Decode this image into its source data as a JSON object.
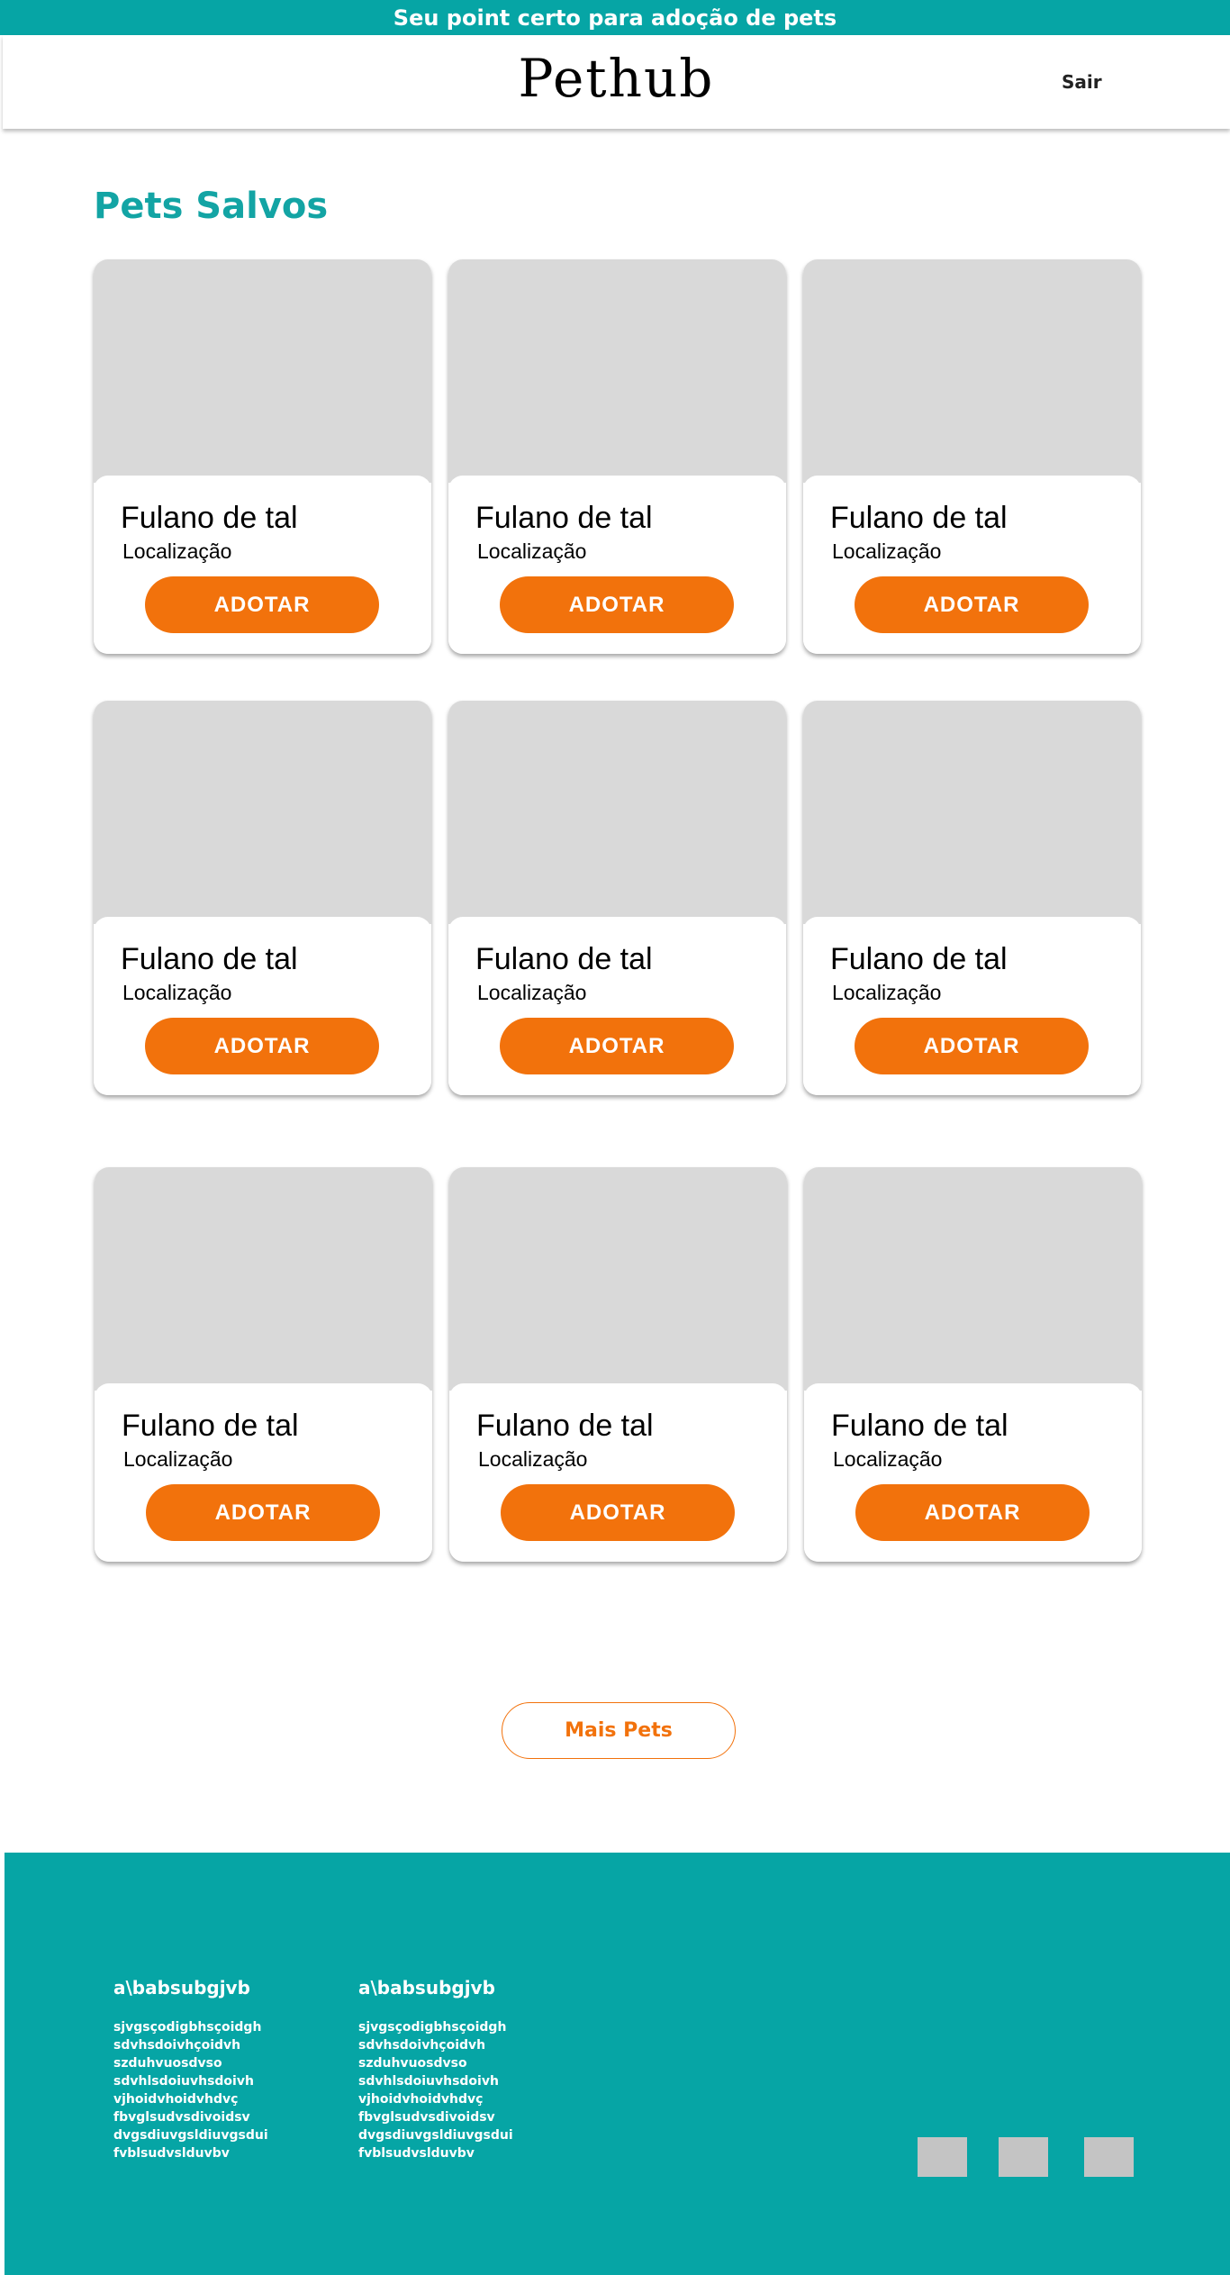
{
  "topbar": {
    "text": "Seu point certo para adoção de pets"
  },
  "header": {
    "logo": "Pethub",
    "logout_label": "Sair"
  },
  "section_title": "Pets Salvos",
  "cards": [
    {
      "name": "Fulano de tal",
      "location": "Localização",
      "button": "ADOTAR"
    },
    {
      "name": "Fulano de tal",
      "location": "Localização",
      "button": "ADOTAR"
    },
    {
      "name": "Fulano de tal",
      "location": "Localização",
      "button": "ADOTAR"
    },
    {
      "name": "Fulano de tal",
      "location": "Localização",
      "button": "ADOTAR"
    },
    {
      "name": "Fulano de tal",
      "location": "Localização",
      "button": "ADOTAR"
    },
    {
      "name": "Fulano de tal",
      "location": "Localização",
      "button": "ADOTAR"
    },
    {
      "name": "Fulano de tal",
      "location": "Localização",
      "button": "ADOTAR"
    },
    {
      "name": "Fulano de tal",
      "location": "Localização",
      "button": "ADOTAR"
    },
    {
      "name": "Fulano de tal",
      "location": "Localização",
      "button": "ADOTAR"
    }
  ],
  "more_button": "Mais Pets",
  "footer": {
    "columns": [
      {
        "title": "a\\babsubgjvb",
        "items": [
          "sjvgsçodigbhsçoidgh",
          "sdvhsdoivhçoidvh",
          "szduhvuosdvso",
          "sdvhlsdoiuvhsdoivh",
          "vjhoidvhoidvhdvç",
          "fbvglsudvsdivoidsv",
          "dvgsdiuvgsldiuvgsdui",
          "fvblsudvslduvbv"
        ]
      },
      {
        "title": "a\\babsubgjvb",
        "items": [
          "sjvgsçodigbhsçoidgh",
          "sdvhsdoivhçoidvh",
          "szduhvuosdvso",
          "sdvhlsdoiuvhsdoivh",
          "vjhoidvhoidvhdvç",
          "fbvglsudvsdivoidsv",
          "dvgsdiuvgsldiuvgsdui",
          "fvblsudvslduvbv"
        ]
      }
    ]
  },
  "colors": {
    "brand_teal": "#06a5a5",
    "accent_orange": "#f2720c",
    "placeholder_gray": "#d9d9d9"
  }
}
